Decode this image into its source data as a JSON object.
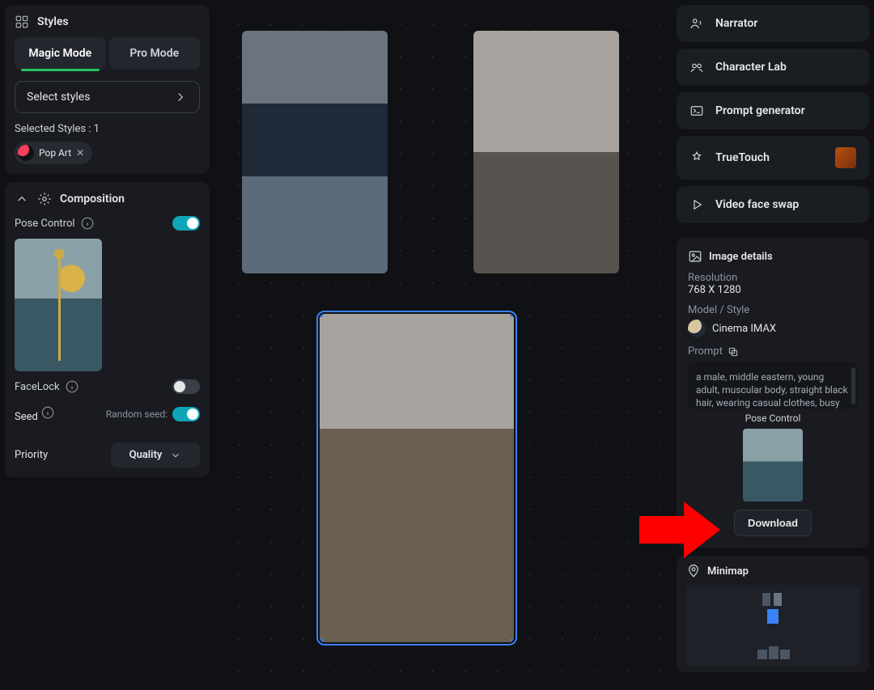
{
  "styles": {
    "title": "Styles",
    "tabs": {
      "magic": "Magic Mode",
      "pro": "Pro Mode",
      "active": "magic"
    },
    "select_label": "Select styles",
    "selected_label": "Selected Styles : 1",
    "chip": {
      "name": "Pop Art"
    }
  },
  "composition": {
    "title": "Composition",
    "pose_control_label": "Pose Control",
    "facelock_label": "FaceLock",
    "seed_label": "Seed",
    "random_seed_label": "Random seed:",
    "priority_label": "Priority",
    "priority_value": "Quality",
    "pose_on": true,
    "facelock_on": false,
    "random_seed_on": true
  },
  "tools": {
    "narrator": "Narrator",
    "character_lab": "Character Lab",
    "prompt_generator": "Prompt generator",
    "truetouch": "TrueTouch",
    "video_face_swap": "Video face swap"
  },
  "details": {
    "title": "Image details",
    "resolution_label": "Resolution",
    "resolution_value": "768 X 1280",
    "model_label": "Model / Style",
    "model_value": "Cinema IMAX",
    "prompt_label": "Prompt",
    "prompt_text": "a male, middle eastern, young adult, muscular body, straight black hair, wearing casual clothes, busy street in",
    "pose_control_label": "Pose Control",
    "download_label": "Download"
  },
  "minimap": {
    "title": "Minimap"
  }
}
